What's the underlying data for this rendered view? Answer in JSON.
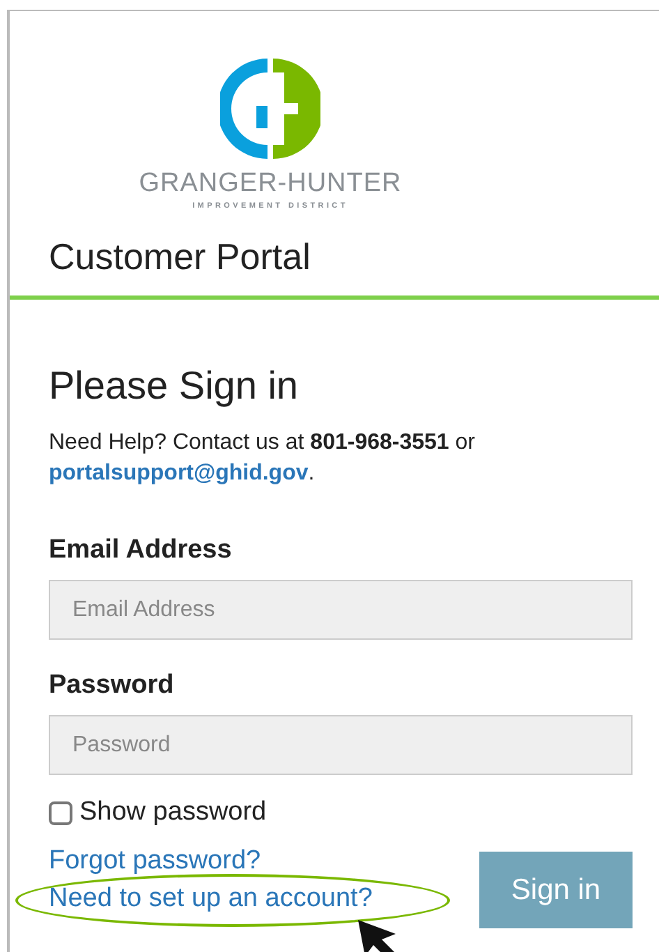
{
  "logo": {
    "name": "GRANGER-HUNTER",
    "subtitle": "IMPROVEMENT DISTRICT"
  },
  "header": {
    "title": "Customer Portal"
  },
  "form": {
    "heading": "Please Sign in",
    "help": {
      "text": "Need Help? Contact us at **801-968-3551** or",
      "link": "portalsupport@ghid.gov",
      "after": "."
    },
    "fields": [
      {
        "label": "Email Address",
        "placeholder": "Email Address"
      },
      {
        "label": "Password",
        "placeholder": "Password"
      }
    ],
    "show_password": {
      "label": "Show password",
      "checked": false
    },
    "links": [
      {
        "label": "Forgot password?",
        "highlighted": false
      },
      {
        "label": "Need to set up an account?",
        "highlighted": true
      }
    ],
    "submit": "Sign in"
  }
}
